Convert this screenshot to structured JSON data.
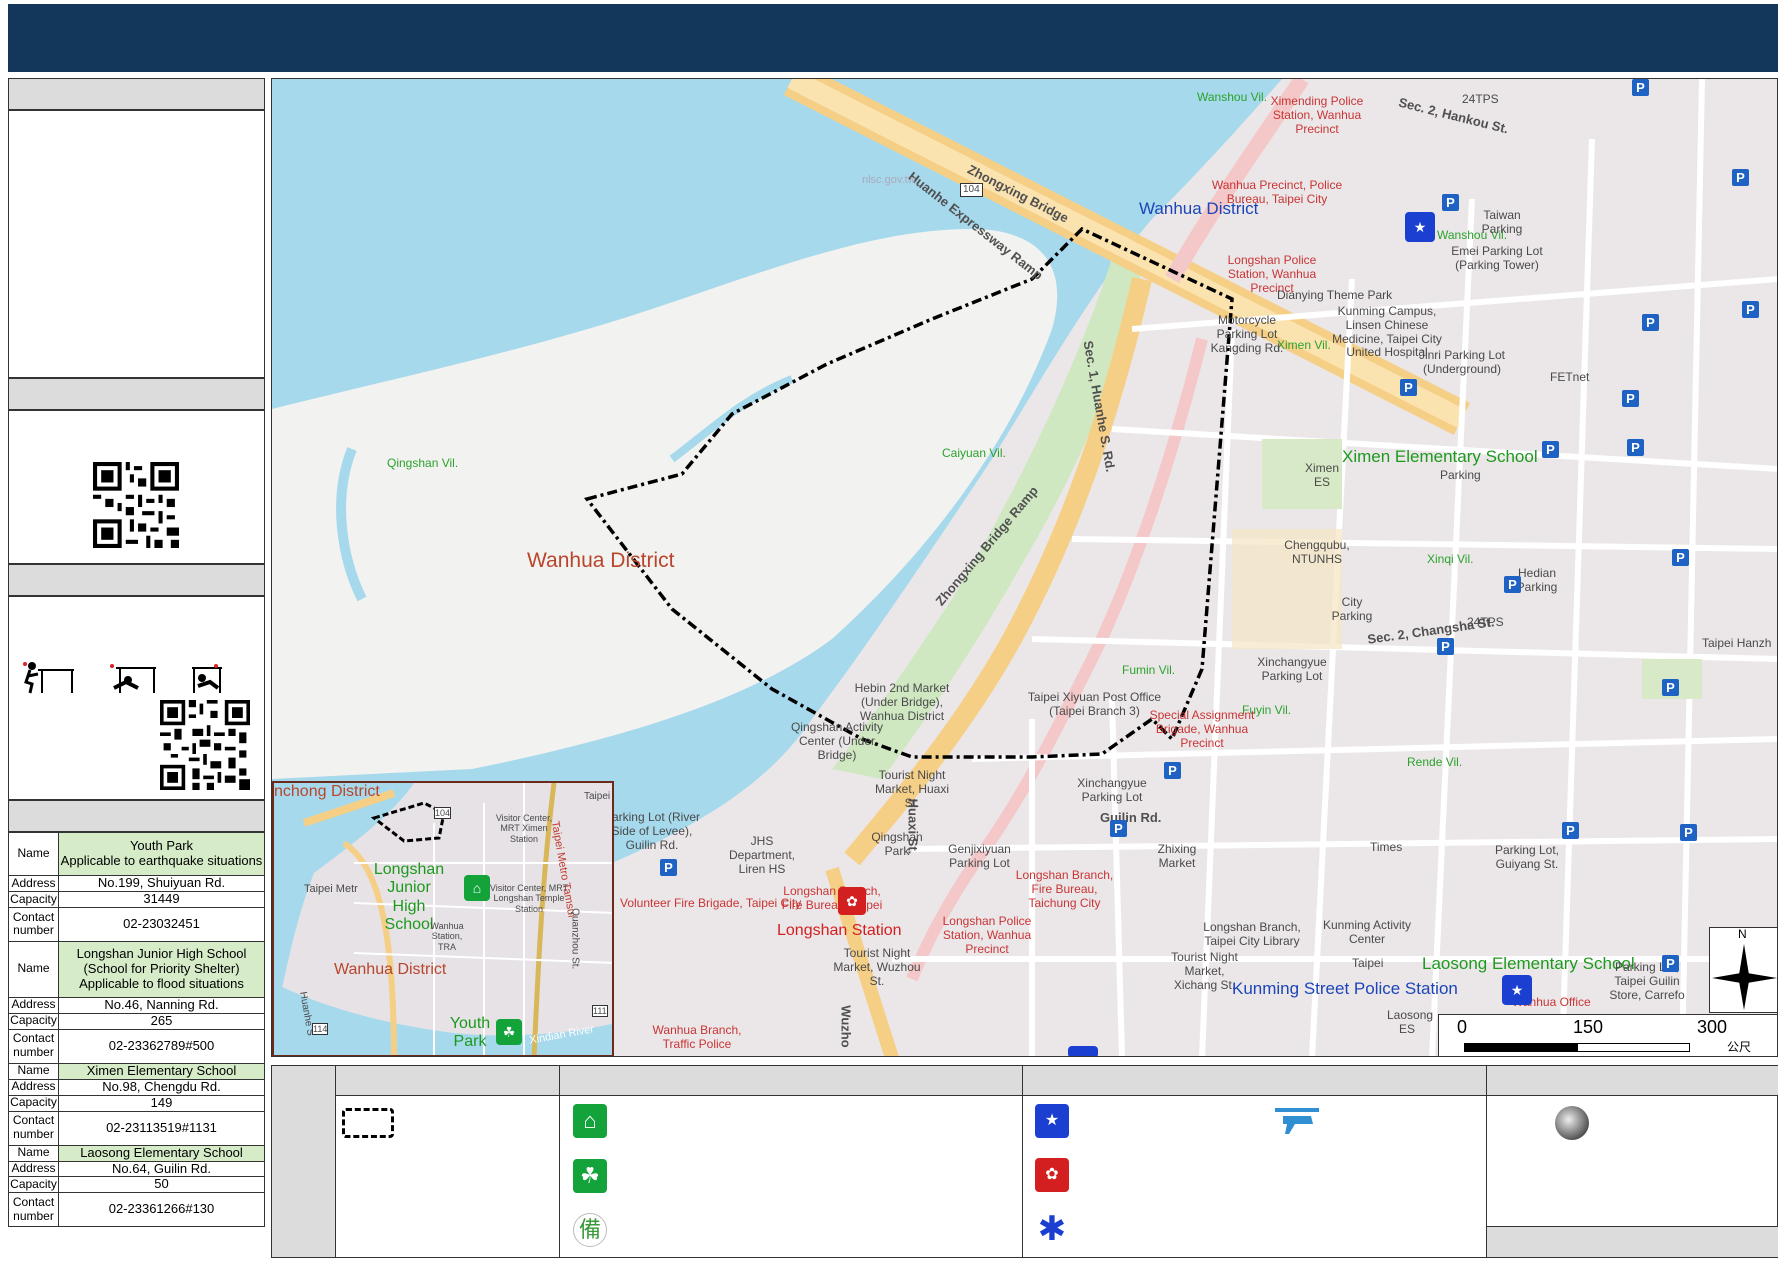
{
  "shelters": [
    {
      "name_label": "Name",
      "name": "Youth Park",
      "note": "Applicable to earthquake situations",
      "address_label": "Address",
      "address": "No.199, Shuiyuan Rd.",
      "capacity_label": "Capacity",
      "capacity": "31449",
      "contact_label": "Contact number",
      "contact": "02-23032451"
    },
    {
      "name_label": "Name",
      "name": "Longshan Junior High School",
      "note": "(School for Priority Shelter)",
      "note2": "Applicable to flood situations",
      "address_label": "Address",
      "address": "No.46, Nanning Rd.",
      "capacity_label": "Capacity",
      "capacity": "265",
      "contact_label": "Contact number",
      "contact": "02-23362789#500"
    },
    {
      "name_label": "Name",
      "name": "Ximen Elementary School",
      "address_label": "Address",
      "address": "No.98, Chengdu Rd.",
      "capacity_label": "Capacity",
      "capacity": "149",
      "contact_label": "Contact number",
      "contact": "02-23113519#1131"
    },
    {
      "name_label": "Name",
      "name": "Laosong Elementary School",
      "address_label": "Address",
      "address": "No.64, Guilin Rd.",
      "capacity_label": "Capacity",
      "capacity": "50",
      "contact_label": "Contact number",
      "contact": "02-23361266#130"
    }
  ],
  "map": {
    "district_labels": [
      "Wanhua District",
      "Wanhua District"
    ],
    "villages": [
      "Wanshou Vil.",
      "Qingshan Vil.",
      "Caiyuan Vil.",
      "Ximen Vil.",
      "Wanshou Vil.",
      "Xinqi Vil.",
      "Fumin Vil.",
      "Fuyin Vil.",
      "Rende Vil."
    ],
    "roads": [
      "Zhongxing Bridge",
      "Huanhe Expressway Ramp",
      "Sec. 1, Huanhe S. Rd.",
      "Zhongxing Bridge Ramp",
      "Sec. 2, Hankou St.",
      "Sec. 2, Changsha St.",
      "Guilin Rd.",
      "Huaxi St.",
      "Wuzho"
    ],
    "highway_shield": "104",
    "watermark": "nlsc.gov.tw",
    "pois": {
      "ximending_police": "Ximending Police Station, Wanhua Precinct",
      "wanhua_precinct": "Wanhua Precinct, Police Bureau, Taipei City",
      "longshan_police": "Longshan Police Station, Wanhua Precinct",
      "dianying": "Dianying Theme Park",
      "hospital": "Kunming Campus, Linsen Chinese Medicine, Taipei City United Hospital",
      "motorcycle": "Motorcycle Parking Lot Kangding Rd.",
      "emei": "Emei Parking Lot (Parking Tower)",
      "jinri": "Jinri Parking Lot (Underground)",
      "taiwan_parking": "Taiwan Parking",
      "fetnet": "FETnet",
      "tps": "24TPS",
      "ximen_es": "Ximen ES",
      "ximen_school": "Ximen Elementary School",
      "parking": "Parking",
      "chenggubu": "Chengqubu, NTUNHS",
      "city_parking": "City Parking",
      "hedian": "Hedian Parking",
      "hanzh": "Taipei Hanzh",
      "xinchangyue": "Xinchangyue Parking Lot",
      "xiyuan_post": "Taipei Xiyuan Post Office (Taipei Branch 3)",
      "special": "Special Assignment Brigade, Wanhua Precinct",
      "hebin": "Hebin 2nd Market (Under Bridge), Wanhua District",
      "qingshan_activity": "Qingshan Activity Center (Under Bridge)",
      "tourist_market1": "Tourist Night Market, Huaxi St.",
      "xinchangyue2": "Xinchangyue Parking Lot",
      "qingshan_park": "Qingshan Park",
      "genjixiyuan": "Genjixiyuan Parking Lot",
      "longshan_fire": "Longshan Branch, Fire Bureau, Taichung City",
      "longshan_police2": "Longshan Police Station, Wanhua Precinct",
      "zhixing": "Zhixing Market",
      "times": "Times",
      "parking_lot_guiyang": "Parking Lot, Guiyang St.",
      "parking_levee": "Parking Lot (River Side of Levee), Guilin Rd.",
      "jhs_dept": "JHS Department, Liren HS",
      "volunteer": "Volunteer Fire Brigade, Taipei City",
      "longshan_fire2": "Longshan Branch, Fire Bureau, Taipei",
      "longshan_station": "Longshan Station",
      "tourist_wuzhou": "Tourist Night Market, Wuzhou St.",
      "tourist_xichang": "Tourist Night Market, Xichang St.",
      "library": "Longshan Branch, Taipei City Library",
      "kunming_activity": "Kunming Activity Center",
      "laosong_label": "Laosong Elementary School",
      "kunming_police": "Kunming Street Police Station",
      "guilin_parking": "Parking Lot, Taipei Guilin Store, Carrefo",
      "wanhua_office": "Wanhua Office",
      "wanhua_traffic": "Wanhua Branch, Traffic Police",
      "laosong_es": "Laosong ES",
      "taipei_abbr": "Taipei",
      "wanhua_district_police": "Wanhua District"
    },
    "inset": {
      "district1": "nchong District",
      "district2": "Wanhua District",
      "school": "Longshan Junior High School",
      "park": "Youth Park",
      "river": "Xindian River",
      "metro": "Taipei Metro Tamsui",
      "station": "Visitor Center, MRT Ximen Station",
      "temple": "Visitor Center, MRT Longshan Temple Station",
      "wanhua_tra": "Wanhua Station, TRA",
      "taipei_metro": "Taipei Metr",
      "quanzhou": "Quanzhou St.",
      "huanhe": "Huanhe S",
      "shield1": "104",
      "shield2": "111",
      "shield3": "114",
      "taipei": "Taipei"
    },
    "scale": {
      "ticks": [
        "0",
        "150",
        "300"
      ],
      "unit": "公尺"
    },
    "compass": "N"
  }
}
